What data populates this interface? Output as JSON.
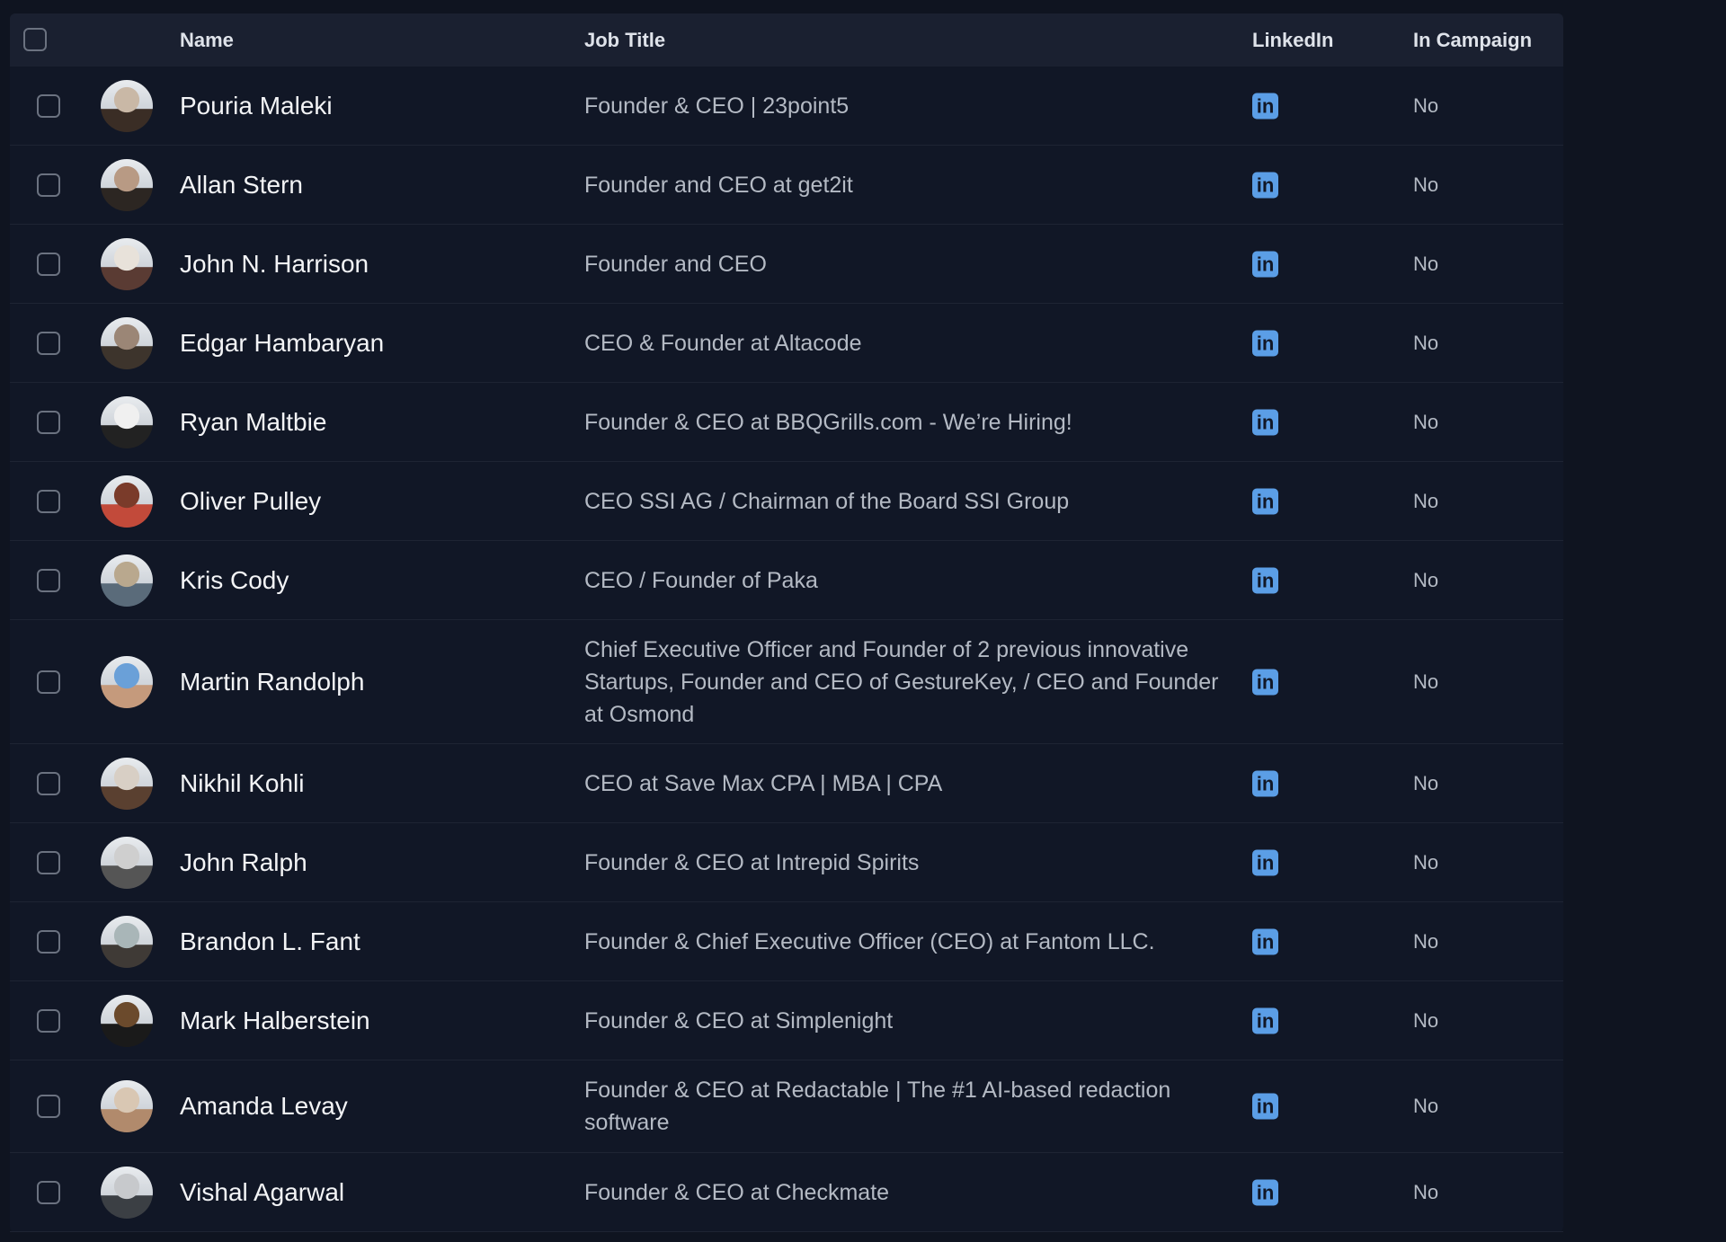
{
  "headers": {
    "name": "Name",
    "job_title": "Job Title",
    "linkedin": "LinkedIn",
    "in_campaign": "In Campaign"
  },
  "rows": [
    {
      "name": "Pouria Maleki",
      "job": "Founder & CEO | 23point5",
      "campaign": "No"
    },
    {
      "name": "Allan Stern",
      "job": "Founder and CEO at get2it",
      "campaign": "No"
    },
    {
      "name": "John N. Harrison",
      "job": "Founder and CEO",
      "campaign": "No"
    },
    {
      "name": "Edgar Hambaryan",
      "job": "CEO & Founder at Altacode",
      "campaign": "No"
    },
    {
      "name": "Ryan Maltbie",
      "job": "Founder & CEO at BBQGrills.com - We’re Hiring!",
      "campaign": "No"
    },
    {
      "name": "Oliver Pulley",
      "job": "CEO SSI AG / Chairman of the Board SSI Group",
      "campaign": "No"
    },
    {
      "name": "Kris Cody",
      "job": "CEO / Founder of Paka",
      "campaign": "No"
    },
    {
      "name": "Martin Randolph",
      "job": "Chief Executive Officer and Founder of 2 previous innovative Startups, Founder and CEO of GestureKey, / CEO and Founder at Osmond",
      "campaign": "No"
    },
    {
      "name": "Nikhil Kohli",
      "job": "CEO at Save Max CPA | MBA | CPA",
      "campaign": "No"
    },
    {
      "name": "John Ralph",
      "job": "Founder & CEO at Intrepid Spirits",
      "campaign": "No"
    },
    {
      "name": "Brandon L. Fant",
      "job": "Founder & Chief Executive Officer (CEO) at Fantom LLC.",
      "campaign": "No"
    },
    {
      "name": "Mark Halberstein",
      "job": "Founder & CEO at Simplenight",
      "campaign": "No"
    },
    {
      "name": "Amanda Levay",
      "job": "Founder & CEO at Redactable | The #1 AI-based redaction software",
      "campaign": "No"
    },
    {
      "name": "Vishal Agarwal",
      "job": "Founder & CEO at Checkmate",
      "campaign": "No"
    }
  ],
  "linkedin_icon_text": "in",
  "colors": {
    "background": "#0f1420",
    "header": "#1a2030",
    "linkedin": "#5b9ee6"
  }
}
